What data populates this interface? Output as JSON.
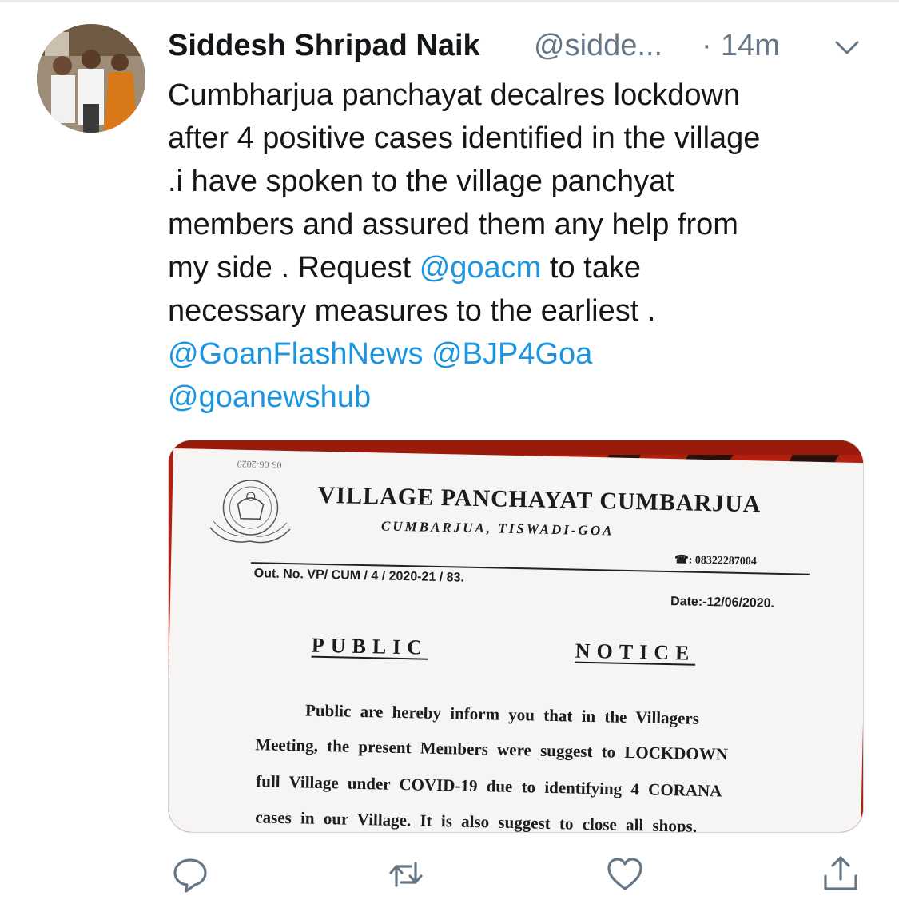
{
  "tweet": {
    "author_name": "Siddesh Shripad Naik",
    "author_handle": "@sidde...",
    "separator": "·",
    "timestamp": "14m",
    "text_lines": [
      "Cumbharjua panchayat decalres lockdown",
      "after 4 positive cases identified in the village",
      ".i have spoken to the village panchyat",
      "members and assured them any help from"
    ],
    "line5_prefix": "my side . Request ",
    "line5_mention": "@goacm",
    "line5_suffix": " to take",
    "line6": "necessary measures to the earliest .",
    "mentions": [
      "@GoanFlashNews",
      "@BJP4Goa",
      "@goanewshub"
    ]
  },
  "media": {
    "stamp": "05-06-2020",
    "title": "VILLAGE PANCHAYAT CUMBARJUA",
    "subtitle": "CUMBARJUA, TISWADI-GOA",
    "phone": "☎: 08322287004",
    "out_no": "Out. No. VP/ CUM / 4 / 2020-21 / 83.",
    "date": "Date:-12/06/2020.",
    "notice_word_1": "PUBLIC",
    "notice_word_2": "NOTICE",
    "body_lines": [
      "Public are hereby inform you that in the Villagers",
      "Meeting, the present Members were suggest to LOCKDOWN",
      "full Village under COVID-19 due to identifying 4 CORANA",
      "cases in our Village.  It is also suggest to close all shops,"
    ]
  },
  "actions": {
    "reply_icon": "speech-bubble-icon",
    "retweet_icon": "retweet-arrows-icon",
    "like_icon": "heart-icon",
    "share_icon": "share-upload-icon"
  },
  "colors": {
    "link": "#1b95e0",
    "secondary_text": "#657786",
    "primary_text": "#14171a",
    "icon": "#657786"
  }
}
